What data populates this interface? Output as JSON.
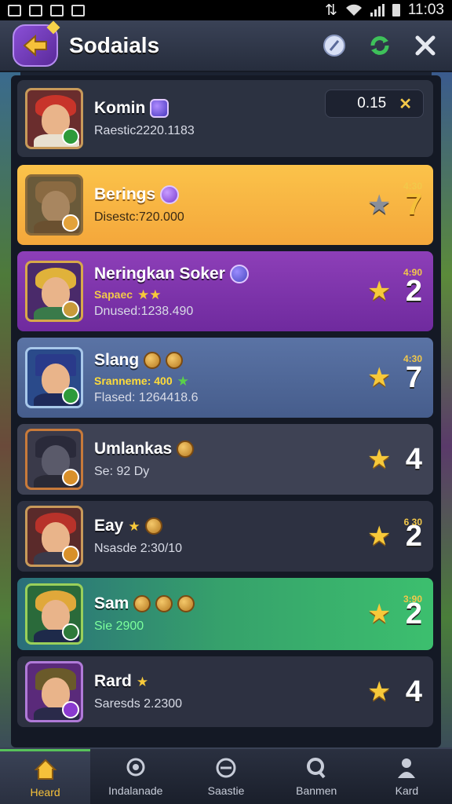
{
  "status_bar": {
    "time": "11:03"
  },
  "header": {
    "title": "Sodaials"
  },
  "players": [
    {
      "name": "Komin",
      "stat": "Raestic2220.1183",
      "score": "0.15",
      "score_close": "✕"
    },
    {
      "name": "Berings",
      "stat": "Disestc:720.000",
      "rank": "7",
      "rank_small": "4:30"
    },
    {
      "name": "Neringkan Soker",
      "tag": "Sapaec",
      "stat": "Dnused:1238.490",
      "rank": "2",
      "rank_small": "4:90"
    },
    {
      "name": "Slang",
      "tag": "Sranneme: 400",
      "stat": "Flased: 1264418.6",
      "rank": "7",
      "rank_small": "4:30"
    },
    {
      "name": "Umlankas",
      "stat": "Se: 92 Dy",
      "rank": "4"
    },
    {
      "name": "Eay",
      "stat": "Nsasde 2:30/10",
      "rank": "2",
      "rank_small": "6 30"
    },
    {
      "name": "Sam",
      "stat": "Sie 2900",
      "rank": "2",
      "rank_small": "3:90"
    },
    {
      "name": "Rard",
      "stat": "Saresds 2.2300",
      "rank": "4"
    }
  ],
  "bottom_nav": [
    {
      "label": "Heard"
    },
    {
      "label": "Indalanade"
    },
    {
      "label": "Saastie"
    },
    {
      "label": "Banmen"
    },
    {
      "label": "Kard"
    }
  ]
}
